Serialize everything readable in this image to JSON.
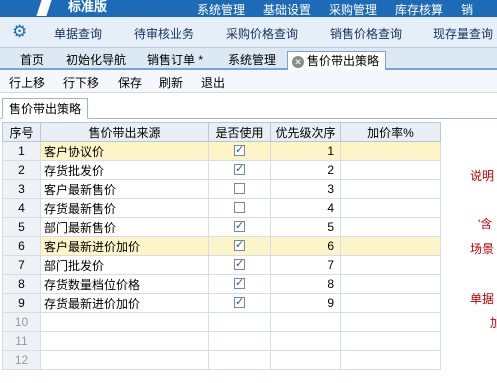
{
  "banner": {
    "edition": "标准版",
    "menu": [
      "系统管理",
      "基础设置",
      "采购管理",
      "库存核算",
      "销"
    ]
  },
  "modules": [
    "单据查询",
    "待审核业务",
    "采购价格查询",
    "销售价格查询",
    "现存量查询"
  ],
  "tabs": [
    "首页",
    "初始化导航",
    "销售订单 *",
    "系统管理",
    "售价带出策略"
  ],
  "toolbar": [
    "行上移",
    "行下移",
    "保存",
    "刷新",
    "退出"
  ],
  "subtab": "售价带出策略",
  "grid": {
    "headers": [
      "序号",
      "售价带出来源",
      "是否使用",
      "优先级次序",
      "加价率%"
    ],
    "rows": [
      {
        "no": "1",
        "source": "客户协议价",
        "used": true,
        "priority": "1",
        "rate": "",
        "highlight": true
      },
      {
        "no": "2",
        "source": "存货批发价",
        "used": true,
        "priority": "2",
        "rate": "",
        "highlight": false
      },
      {
        "no": "3",
        "source": "客户最新售价",
        "used": false,
        "priority": "3",
        "rate": "",
        "highlight": false
      },
      {
        "no": "4",
        "source": "存货最新售价",
        "used": false,
        "priority": "4",
        "rate": "",
        "highlight": false
      },
      {
        "no": "5",
        "source": "部门最新售价",
        "used": true,
        "priority": "5",
        "rate": "",
        "highlight": false
      },
      {
        "no": "6",
        "source": "客户最新进价加价",
        "used": true,
        "priority": "6",
        "rate": "",
        "highlight": true
      },
      {
        "no": "7",
        "source": "部门批发价",
        "used": true,
        "priority": "7",
        "rate": "",
        "highlight": false
      },
      {
        "no": "8",
        "source": "存货数量档位价格",
        "used": true,
        "priority": "8",
        "rate": "",
        "highlight": false
      },
      {
        "no": "9",
        "source": "存货最新进价加价",
        "used": true,
        "priority": "9",
        "rate": "",
        "highlight": false
      },
      {
        "no": "10",
        "source": "",
        "used": null,
        "priority": "",
        "rate": "",
        "highlight": false
      },
      {
        "no": "11",
        "source": "",
        "used": null,
        "priority": "",
        "rate": "",
        "highlight": false
      },
      {
        "no": "12",
        "source": "",
        "used": null,
        "priority": "",
        "rate": "",
        "highlight": false
      }
    ]
  },
  "notes": [
    "说明",
    "（",
    "'含",
    "场景",
    "（",
    "单据",
    "加"
  ],
  "colors": {
    "accent": "#1d6bb7",
    "highlight": "#fdf5c8",
    "note": "#c00000"
  }
}
